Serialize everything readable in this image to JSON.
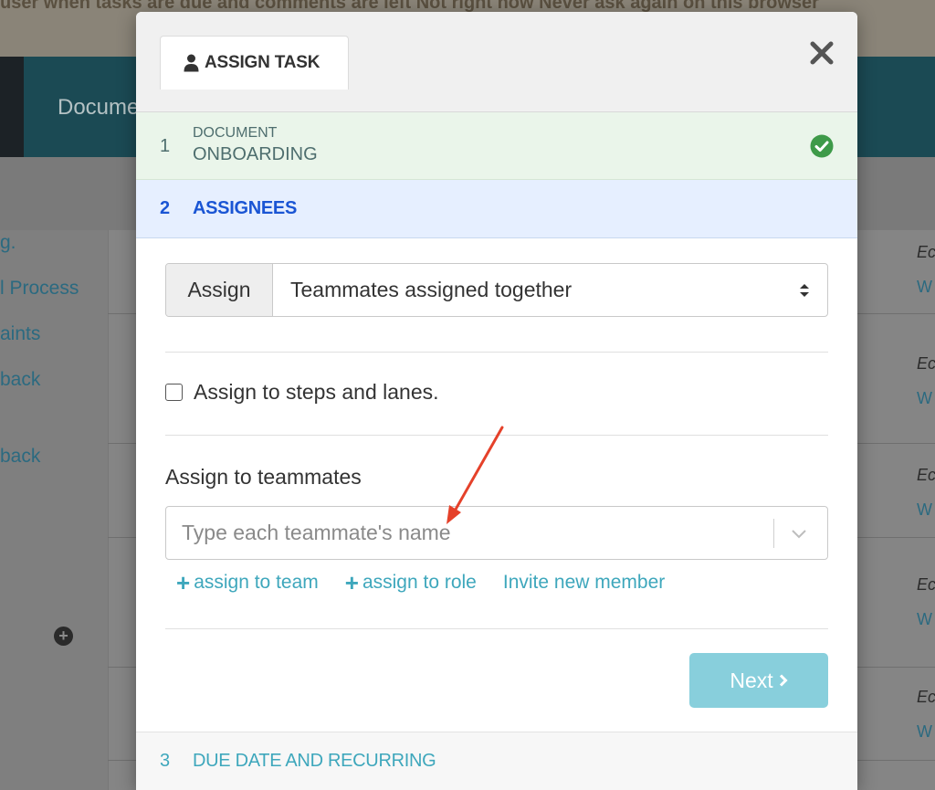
{
  "background": {
    "banner_text": "user when tasks are due and comments are left    Not right now      Never ask again on this browser",
    "nav_label": "Docume",
    "sidebar_links": [
      "g.",
      "l Process",
      "aints",
      "back",
      "back"
    ],
    "right_fragments": [
      "Ec",
      "W"
    ]
  },
  "modal": {
    "tab_label": "ASSIGN TASK",
    "close_label": "Close",
    "steps": [
      {
        "number": "1",
        "small": "DOCUMENT",
        "title": "ONBOARDING",
        "status": "complete"
      },
      {
        "number": "2",
        "title": "ASSIGNEES",
        "status": "active"
      },
      {
        "number": "3",
        "title": "DUE DATE AND RECURRING",
        "status": "pending"
      }
    ],
    "assign_addon": "Assign",
    "assign_select_value": "Teammates assigned together",
    "checkbox_label": "Assign to steps and lanes.",
    "checkbox_checked": false,
    "teammates_label": "Assign to teammates",
    "teammates_placeholder": "Type each teammate's name",
    "links": {
      "assign_team": "assign to team",
      "assign_role": "assign to role",
      "invite": "Invite new member"
    },
    "next_label": "Next"
  },
  "colors": {
    "accent": "#3ea7bc",
    "active_step": "#1a55d4",
    "success": "#3e9a49",
    "next_button": "#88cfdc",
    "annotation_arrow": "#e5412a"
  }
}
